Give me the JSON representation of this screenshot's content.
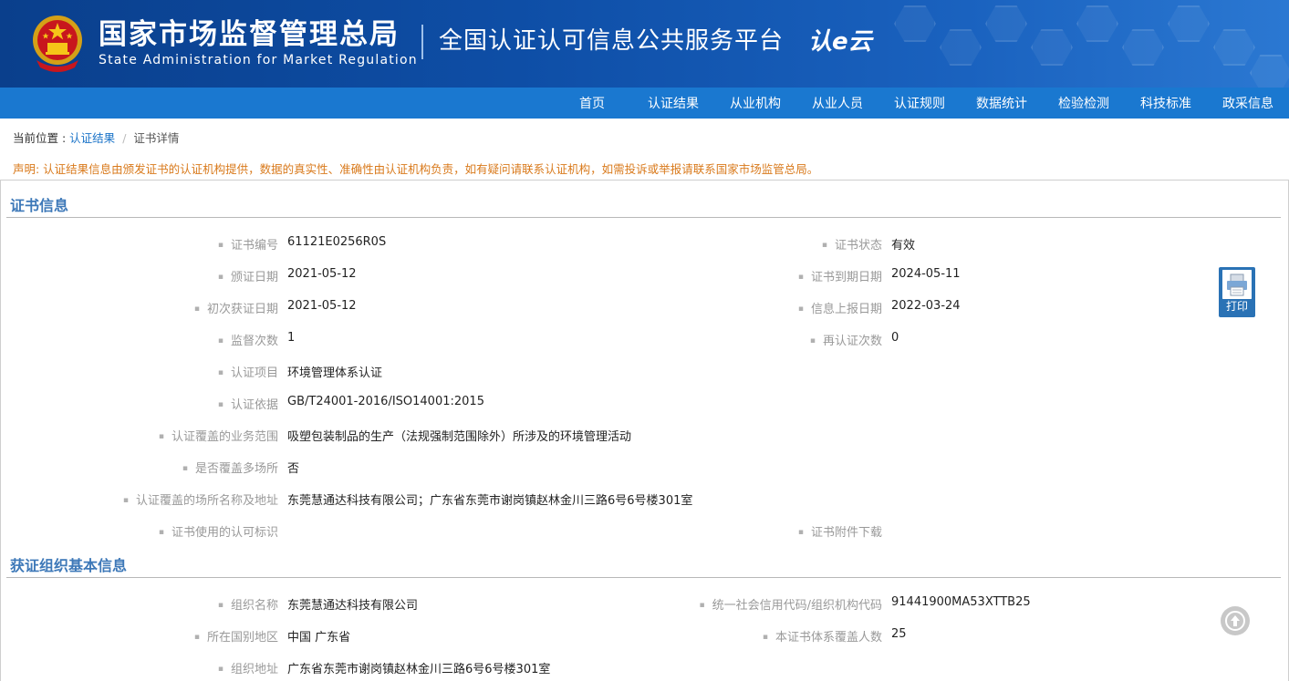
{
  "header": {
    "org_cn": "国家市场监督管理总局",
    "org_en": "State Administration  for  Market Regulation",
    "platform": "全国认证认可信息公共服务平台",
    "logo_mark": "认e云"
  },
  "nav": [
    "首页",
    "认证结果",
    "从业机构",
    "从业人员",
    "认证规则",
    "数据统计",
    "检验检测",
    "科技标准",
    "政采信息"
  ],
  "breadcrumb": {
    "prefix": "当前位置 : ",
    "link": "认证结果",
    "separator": "/",
    "current": "证书详情"
  },
  "notice": "声明: 认证结果信息由颁发证书的认证机构提供，数据的真实性、准确性由认证机构负责，如有疑问请联系认证机构，如需投诉或举报请联系国家市场监管总局。",
  "cert_info": {
    "title": "证书信息",
    "left": [
      {
        "label": "证书编号",
        "value": "61121E0256R0S"
      },
      {
        "label": "颁证日期",
        "value": "2021-05-12"
      },
      {
        "label": "初次获证日期",
        "value": "2021-05-12"
      },
      {
        "label": "监督次数",
        "value": "1"
      },
      {
        "label": "认证项目",
        "value": "环境管理体系认证"
      },
      {
        "label": "认证依据",
        "value": "GB/T24001-2016/ISO14001:2015"
      },
      {
        "label": "认证覆盖的业务范围",
        "value": "吸塑包装制品的生产（法规强制范围除外）所涉及的环境管理活动"
      },
      {
        "label": "是否覆盖多场所",
        "value": "否"
      },
      {
        "label": "认证覆盖的场所名称及地址",
        "value": "东莞慧通达科技有限公司；广东省东莞市谢岗镇赵林金川三路6号6号楼301室"
      },
      {
        "label": "证书使用的认可标识",
        "value": ""
      }
    ],
    "right": [
      {
        "label": "证书状态",
        "value": "有效"
      },
      {
        "label": "证书到期日期",
        "value": "2024-05-11"
      },
      {
        "label": "信息上报日期",
        "value": "2022-03-24"
      },
      {
        "label": "再认证次数",
        "value": "0"
      },
      {
        "label": "证书附件下载",
        "value": ""
      }
    ]
  },
  "org_info": {
    "title": "获证组织基本信息",
    "left": [
      {
        "label": "组织名称",
        "value": "东莞慧通达科技有限公司"
      },
      {
        "label": "所在国别地区",
        "value": "中国 广东省"
      },
      {
        "label": "组织地址",
        "value": "广东省东莞市谢岗镇赵林金川三路6号6号楼301室"
      }
    ],
    "right": [
      {
        "label": "统一社会信用代码/组织机构代码",
        "value": "91441900MA53XTTB25"
      },
      {
        "label": "本证书体系覆盖人数",
        "value": "25"
      }
    ]
  },
  "print_label": "打印",
  "icons": {
    "emblem": "national-emblem-icon",
    "print": "printer-icon",
    "back_to_top": "arrow-up-circle-icon"
  },
  "colors": {
    "banner": "#0e4ea6",
    "nav": "#1a78d0",
    "section_title": "#3d78b8",
    "notice": "#d97a1c",
    "link": "#1a73c8"
  }
}
